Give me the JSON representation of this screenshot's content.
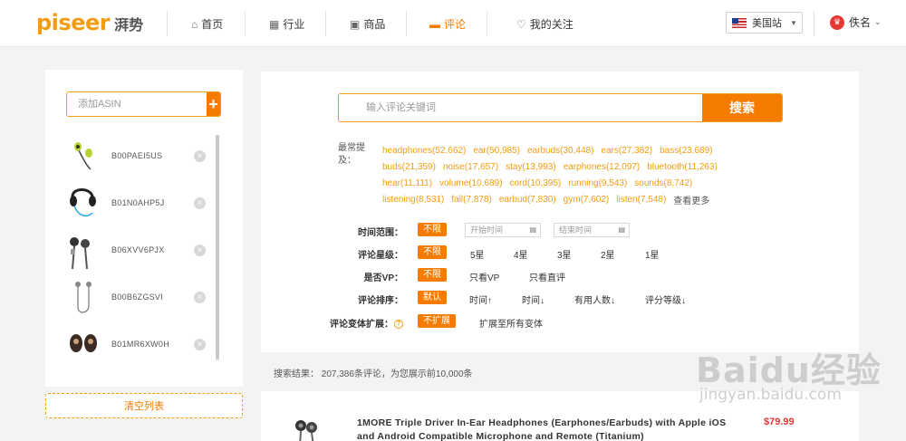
{
  "header": {
    "logo_en": "piseer",
    "logo_cn": "湃势",
    "nav": [
      {
        "label": "首页",
        "icon": "home-icon"
      },
      {
        "label": "行业",
        "icon": "grid-icon"
      },
      {
        "label": "商品",
        "icon": "product-icon"
      },
      {
        "label": "评论",
        "icon": "comment-icon",
        "active": true
      },
      {
        "label": "我的关注",
        "icon": "heart-icon"
      }
    ],
    "region": "美国站",
    "user": "佚名",
    "accent_color": "#f57c00"
  },
  "sidebar": {
    "add_placeholder": "添加ASIN",
    "add_button": "+",
    "asins": [
      "B00PAEI5US",
      "B01N0AHP5J",
      "B06XVV6PJX",
      "B00B6ZGSVI",
      "B01MR6XW0H"
    ],
    "clear_button": "清空列表"
  },
  "search": {
    "placeholder": "输入评论关键词",
    "button": "搜索",
    "keywords_label": "最常提及：",
    "keywords": [
      [
        "headphones(52,662)",
        "ear(50,985)",
        "earbuds(30,448)",
        "ears(27,382)",
        "bass(23,689)"
      ],
      [
        "buds(21,359)",
        "noise(17,657)",
        "stay(13,993)",
        "earphones(12,097)",
        "bluetooth(11,263)"
      ],
      [
        "hear(11,111)",
        "volume(10,689)",
        "cord(10,395)",
        "running(9,543)",
        "sounds(8,742)"
      ],
      [
        "listening(8,531)",
        "fall(7,878)",
        "earbud(7,830)",
        "gym(7,602)",
        "listen(7,548)"
      ]
    ],
    "more": "查看更多"
  },
  "filters": {
    "time": {
      "label": "时间范围：",
      "selected": "不限",
      "start_placeholder": "开始时间",
      "end_placeholder": "结束时间"
    },
    "rating": {
      "label": "评论星级：",
      "options": [
        "不限",
        "5星",
        "4星",
        "3星",
        "2星",
        "1星"
      ]
    },
    "vp": {
      "label": "是否VP：",
      "options": [
        "不限",
        "只看VP",
        "只看直评"
      ]
    },
    "sort": {
      "label": "评论排序：",
      "options": [
        "默认",
        "时间↑",
        "时间↓",
        "有用人数↓",
        "评分等级↓"
      ]
    },
    "variant": {
      "label": "评论变体扩展：",
      "options": [
        "不扩展",
        "扩展至所有变体"
      ]
    }
  },
  "results": {
    "summary": "搜索结果： 207,386条评论，为您展示前10,000条"
  },
  "product": {
    "title": "1MORE Triple Driver In-Ear Headphones (Earphones/Earbuds) with Apple iOS and Android Compatible Microphone and Remote (Titanium)",
    "price": "$79.99"
  },
  "watermark": {
    "main": "Baidu经验",
    "sub": "jingyan.baidu.com"
  }
}
